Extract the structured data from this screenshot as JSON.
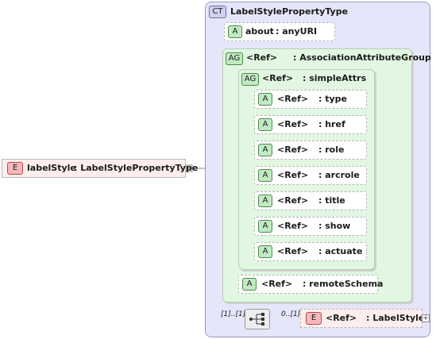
{
  "root_element": {
    "tag": "E",
    "name": "labelStyle",
    "type": ": LabelStylePropertyType"
  },
  "complex_type": {
    "tag": "CT",
    "name": "LabelStylePropertyType"
  },
  "about_attribute": {
    "tag": "A",
    "name": "about",
    "type": ": anyURI"
  },
  "association_group": {
    "tag": "AG",
    "name": "<Ref>",
    "type": ": AssociationAttributeGroup"
  },
  "simple_attrs_group": {
    "tag": "AG",
    "name": "<Ref>",
    "type": ": simpleAttrs"
  },
  "simple_attrs": [
    {
      "tag": "A",
      "name": "<Ref>",
      "type": ": type"
    },
    {
      "tag": "A",
      "name": "<Ref>",
      "type": ": href"
    },
    {
      "tag": "A",
      "name": "<Ref>",
      "type": ": role"
    },
    {
      "tag": "A",
      "name": "<Ref>",
      "type": ": arcrole"
    },
    {
      "tag": "A",
      "name": "<Ref>",
      "type": ": title"
    },
    {
      "tag": "A",
      "name": "<Ref>",
      "type": ": show"
    },
    {
      "tag": "A",
      "name": "<Ref>",
      "type": ": actuate"
    }
  ],
  "remote_schema": {
    "tag": "A",
    "name": "<Ref>",
    "type": ": remoteSchema"
  },
  "sequence": {
    "cardinality": "[1]..[1]"
  },
  "child_element": {
    "tag": "E",
    "name": "<Ref>",
    "type": ": LabelStyle",
    "cardinality": "0..[1]",
    "expand": "+"
  }
}
